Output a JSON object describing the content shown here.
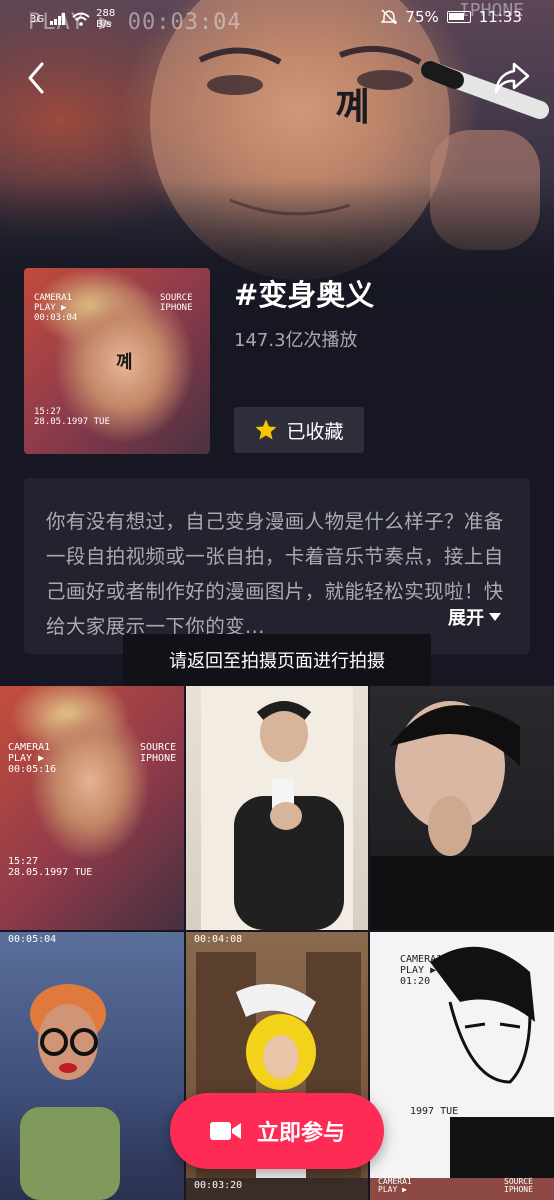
{
  "status_bar": {
    "net_gen": "3G",
    "net_speed_value": "288",
    "net_speed_unit": "B/s",
    "battery": "75%",
    "time": "11:33"
  },
  "hero": {
    "overlay_left": "PLAY ▶ 00:03:04",
    "overlay_right": "IPHONE"
  },
  "topic": {
    "title": "#变身奥义",
    "play_count": "147.3亿次播放",
    "favorite_label": "已收藏",
    "cover_text": {
      "tl": "CAMERA1\nPLAY ▶\n00:03:04",
      "tr": "SOURCE\nIPHONE",
      "mark": "꼐",
      "bl": "15:27\n28.05.1997 TUE"
    }
  },
  "description": {
    "text": "你有没有想过，自己变身漫画人物是什么样子？准备一段自拍视频或一张自拍，卡着音乐节奏点，接上自己画好或者制作好的漫画图片，就能轻松实现啦！快给大家展示一下你的变...",
    "expand_label": "展开"
  },
  "toast": "请返回至拍摄页面进行拍摄",
  "grid": {
    "tile1": {
      "tl": "CAMERA1\nPLAY ▶\n00:05:16",
      "tr": "SOURCE\nIPHONE",
      "bl": "15:27\n28.05.1997 TUE"
    },
    "tile4": {
      "tl": "00:05:04"
    },
    "tile5": {
      "tl": "00:04:08"
    },
    "tile6": {
      "tl": "CAMERA1\nPLAY ▶\n01:20",
      "bl": "1997 TUE"
    },
    "tile7": {
      "tl": "00:03:20"
    },
    "tile8": {
      "tl": "CAMERA1\nPLAY ▶",
      "tr": "SOURCE\nIPHONE"
    }
  },
  "join_button": {
    "label": "立即参与"
  },
  "colors": {
    "accent": "#fe2c55",
    "background": "#161722",
    "favorite_star": "#f7c600"
  }
}
